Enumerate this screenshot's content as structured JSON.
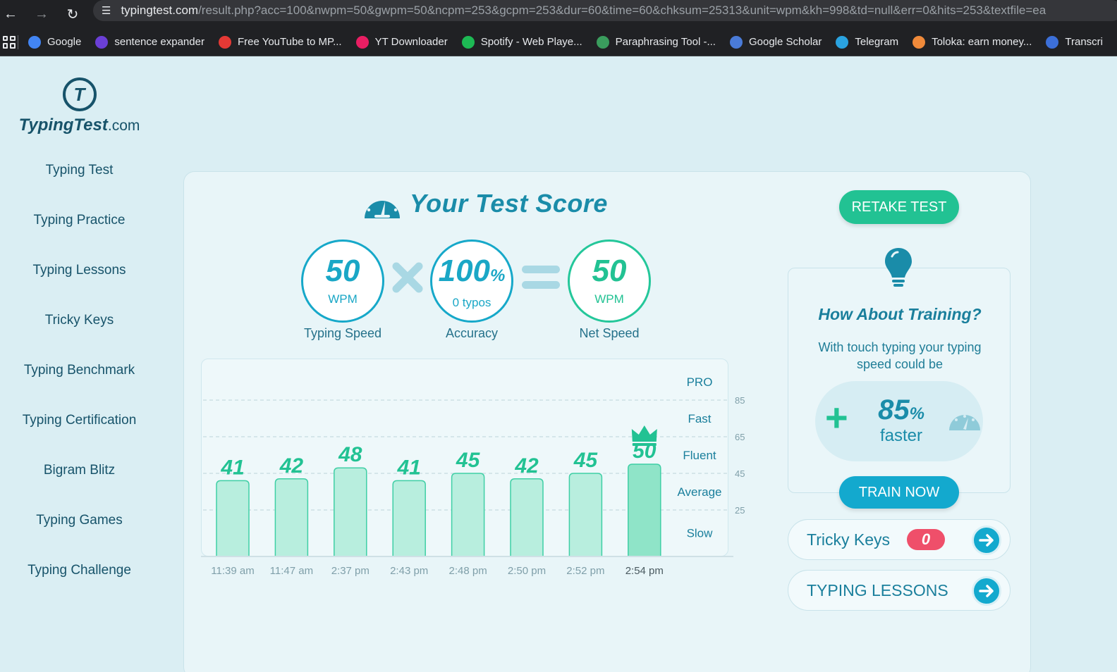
{
  "browser": {
    "site_info_icon": "tune-icon",
    "url_host": "typingtest.com",
    "url_rest": "/result.php?acc=100&nwpm=50&gwpm=50&ncpm=253&gcpm=253&dur=60&time=60&chksum=25313&unit=wpm&kh=998&td=null&err=0&hits=253&textfile=ea",
    "bookmarks": [
      {
        "label": "Google",
        "icon": "google-icon",
        "color": "#4285f4"
      },
      {
        "label": "sentence expander",
        "icon": "w-logo-icon",
        "color": "#6b3fd6"
      },
      {
        "label": "Free YouTube to MP...",
        "icon": "cloud-download-icon",
        "color": "#e53935"
      },
      {
        "label": "YT Downloader",
        "icon": "yt-downloader-icon",
        "color": "#e91e63"
      },
      {
        "label": "Spotify - Web Playe...",
        "icon": "spotify-icon",
        "color": "#1db954"
      },
      {
        "label": "Paraphrasing Tool -...",
        "icon": "robot-icon",
        "color": "#3a9d5d"
      },
      {
        "label": "Google Scholar",
        "icon": "scholar-cap-icon",
        "color": "#4a7bd8"
      },
      {
        "label": "Telegram",
        "icon": "telegram-icon",
        "color": "#2aa3e0"
      },
      {
        "label": "Toloka: earn money...",
        "icon": "toloka-icon",
        "color": "#f08a3a"
      },
      {
        "label": "Transcri",
        "icon": "transcribe-icon",
        "color": "#3c6fd8"
      }
    ]
  },
  "logo": {
    "mark": "T",
    "name": "TypingTest",
    "tld": ".com"
  },
  "sidebar": {
    "items": [
      "Typing Test",
      "Typing Practice",
      "Typing Lessons",
      "Tricky Keys",
      "Typing Benchmark",
      "Typing Certification",
      "Bigram Blitz",
      "Typing Games",
      "Typing Challenge"
    ]
  },
  "score": {
    "title": "Your Test Score",
    "typing_speed": {
      "value": "50",
      "unit": "WPM",
      "label": "Typing Speed"
    },
    "accuracy": {
      "value": "100",
      "unit": "%",
      "sub": "0 typos",
      "label": "Accuracy"
    },
    "net_speed": {
      "value": "50",
      "unit": "WPM",
      "label": "Net Speed"
    }
  },
  "chart_data": {
    "type": "bar",
    "categories": [
      "11:39 am",
      "11:47 am",
      "2:37 pm",
      "2:43 pm",
      "2:48 pm",
      "2:50 pm",
      "2:52 pm",
      "2:54 pm"
    ],
    "values": [
      41,
      42,
      48,
      41,
      45,
      42,
      45,
      50
    ],
    "highlight_index": 7,
    "highlight_icon": "crown-icon",
    "y_ticks": [
      25,
      45,
      65,
      85
    ],
    "levels": [
      "PRO",
      "Fast",
      "Fluent",
      "Average",
      "Slow"
    ],
    "ylim": [
      0,
      105
    ],
    "grid": "dashed horizontal at tick values",
    "colors": {
      "bar": "#b8eede",
      "bar_highlight": "#8fe4c8",
      "bar_border": "#3fcfa5",
      "value_text": "#22c293",
      "level_text": "#1a7f9c",
      "tick_text": "#7f9fa9",
      "category_text": "#7f9fa9",
      "category_highlight_text": "#4a5a60"
    }
  },
  "actions": {
    "retake": "RETAKE TEST",
    "train_now": "TRAIN NOW"
  },
  "training": {
    "title": "How About Training?",
    "text": "With touch typing your typing speed could be",
    "plus": "+",
    "boost_value": "85",
    "boost_unit": "%",
    "boost_word": "faster"
  },
  "links": {
    "tricky_keys": {
      "label": "Tricky Keys",
      "count": "0"
    },
    "typing_lessons": {
      "label": "TYPING LESSONS"
    }
  },
  "colors": {
    "accent": "#1a8ca9",
    "green": "#22c293",
    "blue": "#13a9ce",
    "background": "#daeef3",
    "badge": "#ef4f6a"
  }
}
